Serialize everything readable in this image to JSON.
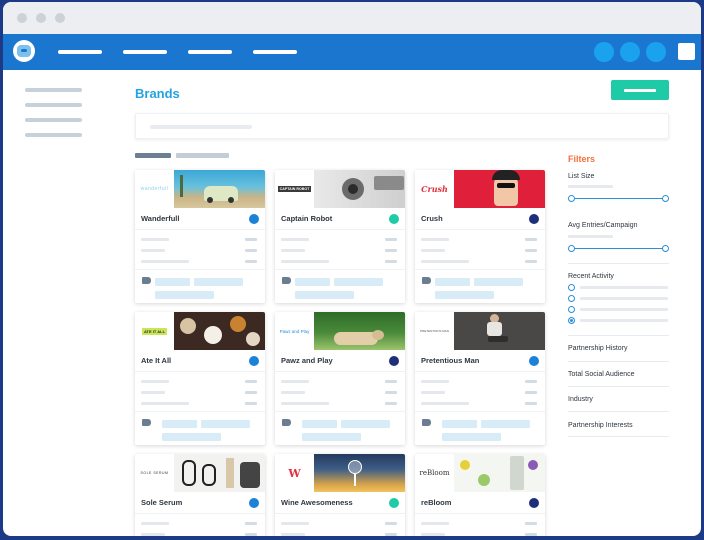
{
  "header": {
    "title": "Brands"
  },
  "filters": {
    "title": "Filters",
    "list_size_label": "List Size",
    "avg_entries_label": "Avg Entries/Campaign",
    "recent_activity_label": "Recent Activity",
    "partnership_history_label": "Partnership History",
    "social_audience_label": "Total Social Audience",
    "industry_label": "Industry",
    "partnership_interests_label": "Partnership Interests"
  },
  "colors": {
    "nav": "#1b76cf",
    "accent": "#22a3e3",
    "primary_button": "#1fcaa6",
    "filters_heading": "#f3713c"
  },
  "cards": [
    {
      "name": "Wanderfull",
      "logo": "wanderfull",
      "status": "#1b82d6"
    },
    {
      "name": "Captain Robot",
      "logo": "CAPTAIN ROBOT",
      "status": "#1fcaa6"
    },
    {
      "name": "Crush",
      "logo": "Crush",
      "status": "#1d2f7a"
    },
    {
      "name": "Ate It All",
      "logo": "ATE IT ALL",
      "status": "#1b82d6"
    },
    {
      "name": "Pawz and Play",
      "logo": "Pawz and Play",
      "status": "#1d2f7a"
    },
    {
      "name": "Pretentious Man",
      "logo": "PRETENTIOUS MAN",
      "status": "#1b82d6"
    },
    {
      "name": "Sole Serum",
      "logo": "SOLE SERUM",
      "status": "#1b82d6"
    },
    {
      "name": "Wine Awesomeness",
      "logo": "W",
      "status": "#1fcaa6"
    },
    {
      "name": "reBloom",
      "logo": "reBloom",
      "status": "#1d2f7a"
    }
  ]
}
